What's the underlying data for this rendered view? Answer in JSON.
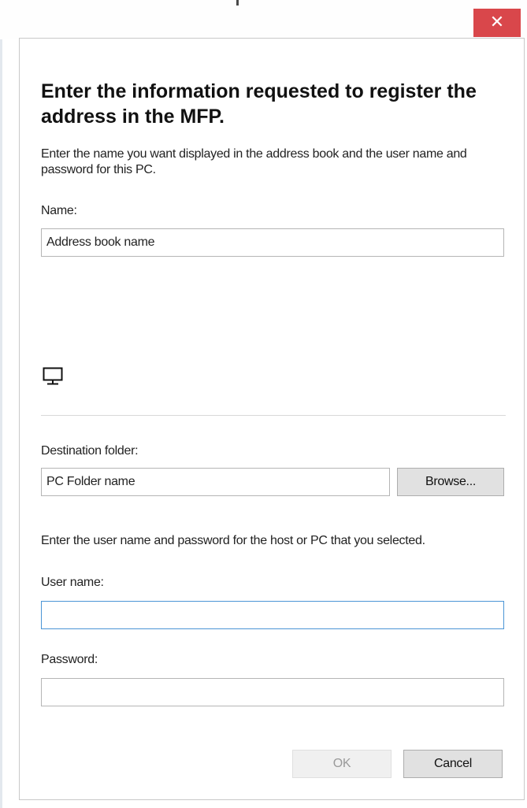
{
  "window": {
    "close_glyph": "✕"
  },
  "dialog": {
    "heading": "Enter the information requested to register the address in the MFP.",
    "description": "Enter the name you want displayed in the address book and the user name and password for this PC.",
    "name_label": "Name:",
    "name_value": "Address book name",
    "destination_icon": "pc-monitor-icon",
    "destination_label": "Destination folder:",
    "destination_value": "PC Folder name",
    "browse_label": "Browse...",
    "credentials_instruction": "Enter the user name and password for the host or PC that you selected.",
    "username_label": "User name:",
    "username_value": "",
    "password_label": "Password:",
    "password_value": "",
    "ok_label": "OK",
    "cancel_label": "Cancel"
  },
  "colors": {
    "close_button_bg": "#d9474b",
    "focus_border": "#4b95d6"
  }
}
